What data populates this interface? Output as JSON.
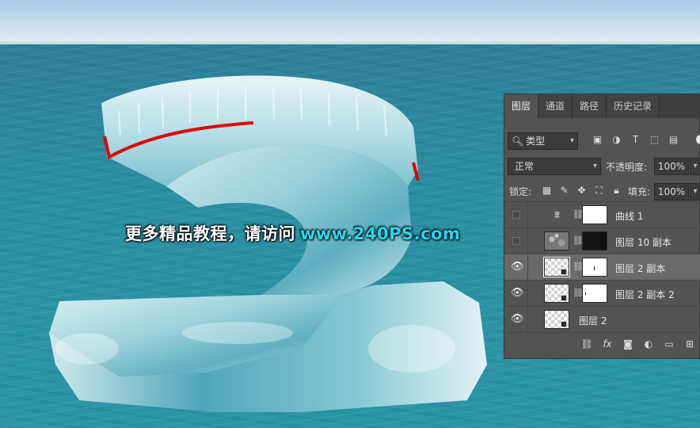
{
  "watermark": {
    "chinese": "更多精品教程，请访问",
    "url": "www.240PS.com"
  },
  "colors": {
    "panel_bg": "#535353",
    "selected_row": "#6a6a6a",
    "watermark_url": "#2ad6f0",
    "edge_red": "#e00000"
  },
  "layers_panel": {
    "tabs": [
      {
        "label": "图层",
        "active": true
      },
      {
        "label": "通道",
        "active": false
      },
      {
        "label": "路径",
        "active": false
      },
      {
        "label": "历史记录",
        "active": false
      }
    ],
    "filter_label": "类型",
    "blend_mode": "正常",
    "opacity_label": "不透明度:",
    "opacity_value": "100%",
    "lock_label": "锁定:",
    "fill_label": "填充:",
    "fill_value": "100%",
    "filter_icons": [
      "image-filter-icon",
      "adjustment-filter-icon",
      "type-filter-icon",
      "shape-filter-icon",
      "smart-object-filter-icon"
    ],
    "lock_icons": [
      "lock-pixels-icon",
      "lock-image-icon",
      "lock-position-icon",
      "lock-artboard-icon",
      "lock-all-icon"
    ],
    "layers": [
      {
        "name": "曲线 1",
        "visible": false,
        "selected": false
      },
      {
        "name": "图层 10 副本",
        "visible": false,
        "selected": false
      },
      {
        "name": "图层 2 副本",
        "visible": true,
        "selected": true
      },
      {
        "name": "图层 2 副本 2",
        "visible": true,
        "selected": false
      },
      {
        "name": "图层 2",
        "visible": true,
        "selected": false
      }
    ],
    "footer_icons": [
      "link-layers-icon",
      "fx-icon",
      "add-mask-icon",
      "adjustment-layer-icon",
      "new-group-icon",
      "new-layer-icon"
    ]
  }
}
